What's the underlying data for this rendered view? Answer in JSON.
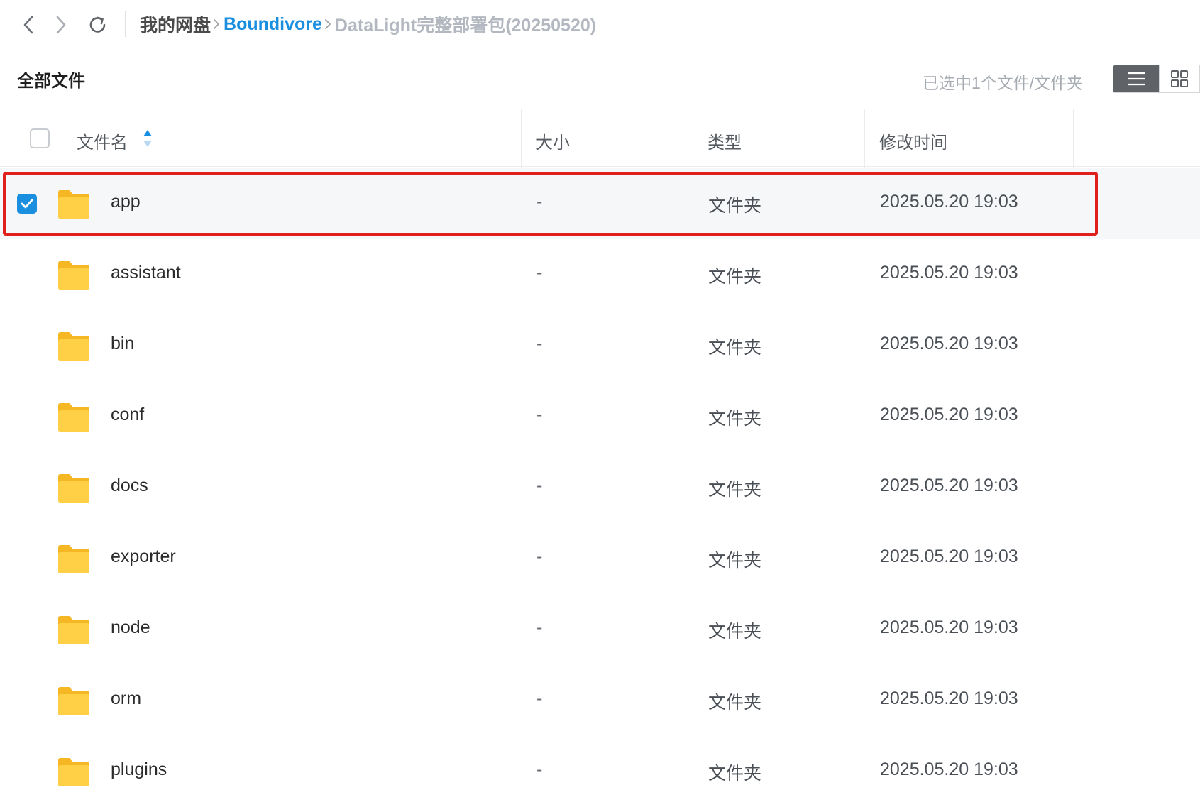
{
  "nav": {
    "breadcrumb": {
      "root": "我的网盘",
      "middle": "Boundivore",
      "current": "DataLight完整部署包(20250520)"
    }
  },
  "section": {
    "title": "全部文件",
    "selection_status": "已选中1个文件/文件夹"
  },
  "table": {
    "columns": {
      "name": "文件名",
      "size": "大小",
      "type": "类型",
      "modified": "修改时间"
    },
    "rows": [
      {
        "name": "app",
        "size": "-",
        "type": "文件夹",
        "modified": "2025.05.20 19:03",
        "selected": true
      },
      {
        "name": "assistant",
        "size": "-",
        "type": "文件夹",
        "modified": "2025.05.20 19:03",
        "selected": false
      },
      {
        "name": "bin",
        "size": "-",
        "type": "文件夹",
        "modified": "2025.05.20 19:03",
        "selected": false
      },
      {
        "name": "conf",
        "size": "-",
        "type": "文件夹",
        "modified": "2025.05.20 19:03",
        "selected": false
      },
      {
        "name": "docs",
        "size": "-",
        "type": "文件夹",
        "modified": "2025.05.20 19:03",
        "selected": false
      },
      {
        "name": "exporter",
        "size": "-",
        "type": "文件夹",
        "modified": "2025.05.20 19:03",
        "selected": false
      },
      {
        "name": "node",
        "size": "-",
        "type": "文件夹",
        "modified": "2025.05.20 19:03",
        "selected": false
      },
      {
        "name": "orm",
        "size": "-",
        "type": "文件夹",
        "modified": "2025.05.20 19:03",
        "selected": false
      },
      {
        "name": "plugins",
        "size": "-",
        "type": "文件夹",
        "modified": "2025.05.20 19:03",
        "selected": false
      }
    ]
  },
  "colors": {
    "accent": "#1a8fe0",
    "highlight": "#e0201c",
    "folder": "#ffc93c"
  },
  "icons": [
    "back-arrow-icon",
    "forward-arrow-icon",
    "refresh-icon",
    "chevron-right-icon",
    "sort-icon",
    "list-view-icon",
    "grid-view-icon",
    "folder-icon",
    "checkmark-icon"
  ]
}
